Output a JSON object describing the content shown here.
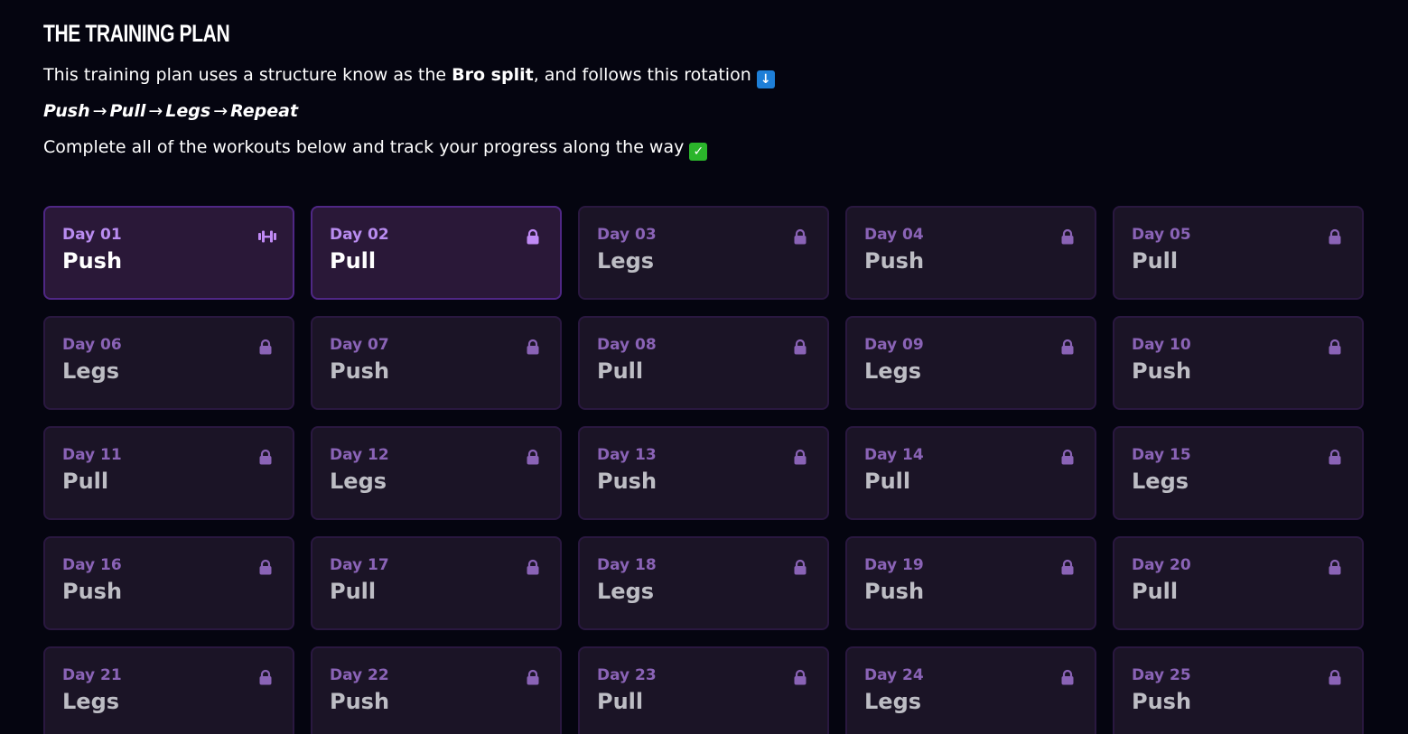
{
  "header": {
    "title": "THE TRAINING PLAN",
    "intro_prefix": "This training plan uses a structure know as the ",
    "intro_bold": "Bro split",
    "intro_suffix": ", and follows this rotation",
    "rotation": [
      "Push",
      "Pull",
      "Legs",
      "Repeat"
    ],
    "rotation_arrow": "→",
    "outro": "Complete all of the workouts below and track your progress along the way"
  },
  "colors": {
    "background": "#050510",
    "card": "#1b1426",
    "card_active": "#2a1838",
    "accent_purple": "#b98cf0",
    "locked_purple": "#8a63b6"
  },
  "days": [
    {
      "day": "Day 01",
      "type": "Push",
      "state": "current",
      "icon": "dumbbell-icon"
    },
    {
      "day": "Day 02",
      "type": "Pull",
      "state": "next",
      "icon": "lock-icon"
    },
    {
      "day": "Day 03",
      "type": "Legs",
      "state": "locked",
      "icon": "lock-icon"
    },
    {
      "day": "Day 04",
      "type": "Push",
      "state": "locked",
      "icon": "lock-icon"
    },
    {
      "day": "Day 05",
      "type": "Pull",
      "state": "locked",
      "icon": "lock-icon"
    },
    {
      "day": "Day 06",
      "type": "Legs",
      "state": "locked",
      "icon": "lock-icon"
    },
    {
      "day": "Day 07",
      "type": "Push",
      "state": "locked",
      "icon": "lock-icon"
    },
    {
      "day": "Day 08",
      "type": "Pull",
      "state": "locked",
      "icon": "lock-icon"
    },
    {
      "day": "Day 09",
      "type": "Legs",
      "state": "locked",
      "icon": "lock-icon"
    },
    {
      "day": "Day 10",
      "type": "Push",
      "state": "locked",
      "icon": "lock-icon"
    },
    {
      "day": "Day 11",
      "type": "Pull",
      "state": "locked",
      "icon": "lock-icon"
    },
    {
      "day": "Day 12",
      "type": "Legs",
      "state": "locked",
      "icon": "lock-icon"
    },
    {
      "day": "Day 13",
      "type": "Push",
      "state": "locked",
      "icon": "lock-icon"
    },
    {
      "day": "Day 14",
      "type": "Pull",
      "state": "locked",
      "icon": "lock-icon"
    },
    {
      "day": "Day 15",
      "type": "Legs",
      "state": "locked",
      "icon": "lock-icon"
    },
    {
      "day": "Day 16",
      "type": "Push",
      "state": "locked",
      "icon": "lock-icon"
    },
    {
      "day": "Day 17",
      "type": "Pull",
      "state": "locked",
      "icon": "lock-icon"
    },
    {
      "day": "Day 18",
      "type": "Legs",
      "state": "locked",
      "icon": "lock-icon"
    },
    {
      "day": "Day 19",
      "type": "Push",
      "state": "locked",
      "icon": "lock-icon"
    },
    {
      "day": "Day 20",
      "type": "Pull",
      "state": "locked",
      "icon": "lock-icon"
    },
    {
      "day": "Day 21",
      "type": "Legs",
      "state": "locked",
      "icon": "lock-icon"
    },
    {
      "day": "Day 22",
      "type": "Push",
      "state": "locked",
      "icon": "lock-icon"
    },
    {
      "day": "Day 23",
      "type": "Pull",
      "state": "locked",
      "icon": "lock-icon"
    },
    {
      "day": "Day 24",
      "type": "Legs",
      "state": "locked",
      "icon": "lock-icon"
    },
    {
      "day": "Day 25",
      "type": "Push",
      "state": "locked",
      "icon": "lock-icon"
    }
  ]
}
